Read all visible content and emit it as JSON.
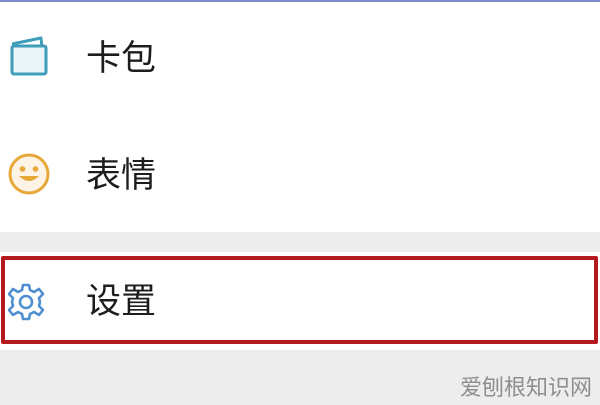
{
  "menu": {
    "items": [
      {
        "label": "卡包",
        "icon": "wallet-card-icon",
        "color": "#3e9db8"
      },
      {
        "label": "表情",
        "icon": "smiley-face-icon",
        "color": "#e7a83a"
      },
      {
        "label": "设置",
        "icon": "gear-icon",
        "color": "#4f8fcf"
      }
    ],
    "highlight_color": "#b4191f"
  },
  "watermark": {
    "text": "爱刨根知识网"
  }
}
